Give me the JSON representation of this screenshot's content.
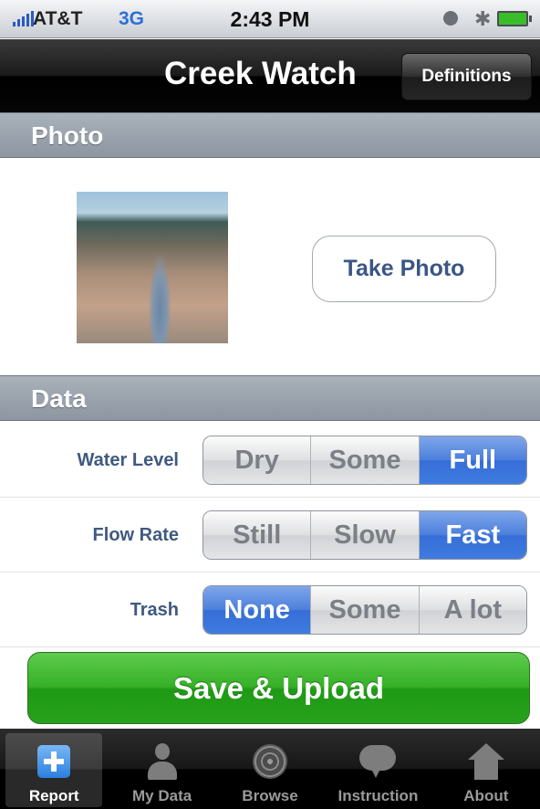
{
  "status_bar": {
    "carrier": "AT&T",
    "network": "3G",
    "time": "2:43 PM",
    "icons": [
      "signal-icon",
      "clock-icon",
      "bluetooth-icon",
      "battery-icon"
    ]
  },
  "nav": {
    "title": "Creek Watch",
    "definitions_label": "Definitions"
  },
  "photo_section": {
    "header": "Photo",
    "take_photo_label": "Take Photo"
  },
  "data_section": {
    "header": "Data",
    "rows": [
      {
        "label": "Water Level",
        "options": [
          "Dry",
          "Some",
          "Full"
        ],
        "selected": "Full"
      },
      {
        "label": "Flow Rate",
        "options": [
          "Still",
          "Slow",
          "Fast"
        ],
        "selected": "Fast"
      },
      {
        "label": "Trash",
        "options": [
          "None",
          "Some",
          "A lot"
        ],
        "selected": "None"
      }
    ]
  },
  "save_label": "Save & Upload",
  "tab_bar": {
    "active": "Report",
    "tabs": [
      {
        "label": "Report",
        "icon": "plus-icon"
      },
      {
        "label": "My Data",
        "icon": "person-icon"
      },
      {
        "label": "Browse",
        "icon": "radar-icon"
      },
      {
        "label": "Instruction",
        "icon": "speech-bubble-icon"
      },
      {
        "label": "About",
        "icon": "house-icon"
      }
    ]
  },
  "colors": {
    "selected_segment": "#3f7be0",
    "save_button": "#27a11c",
    "label_text": "#3f5980",
    "section_header": "#8d96a1"
  }
}
